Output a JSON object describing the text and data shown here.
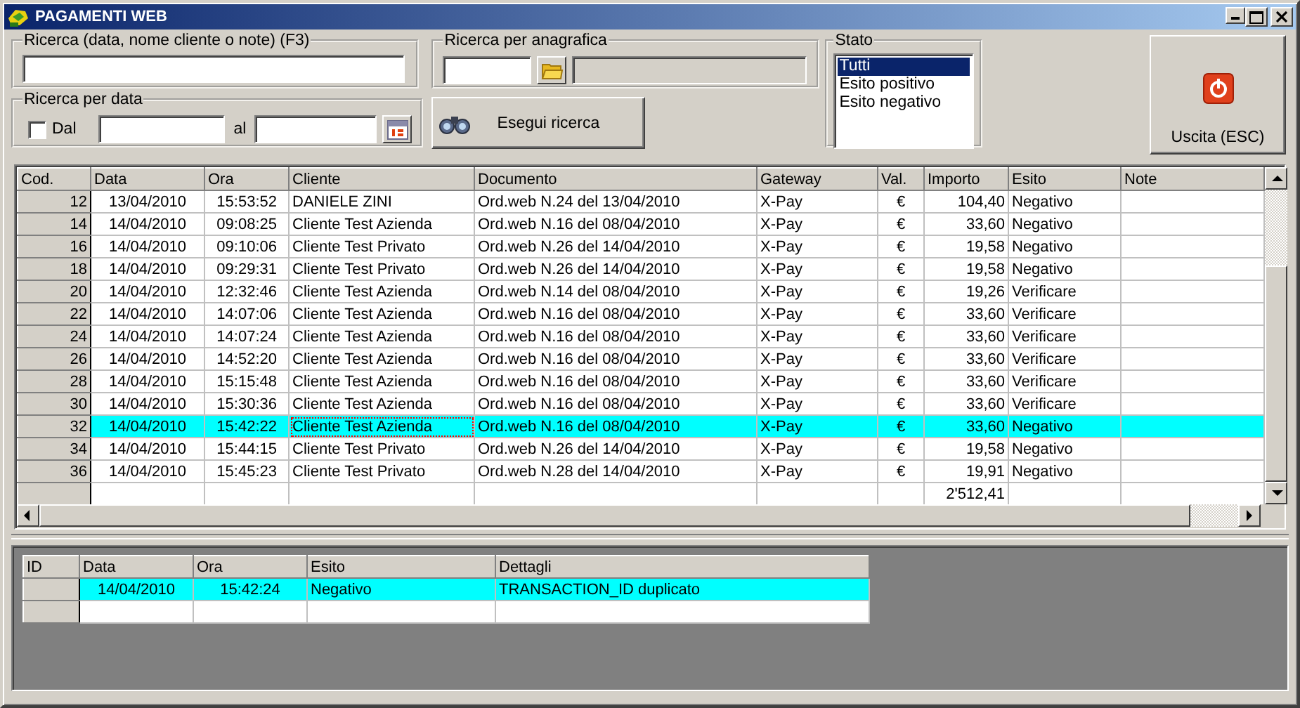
{
  "window": {
    "title": "PAGAMENTI WEB"
  },
  "search": {
    "label": "Ricerca (data, nome cliente o note) (F3)"
  },
  "anagrafica": {
    "label": "Ricerca per anagrafica"
  },
  "date_search": {
    "label": "Ricerca per data",
    "from_label": "Dal",
    "to_label": "al",
    "checked": false
  },
  "run_button": {
    "label": "Esegui ricerca"
  },
  "stato": {
    "label": "Stato",
    "items": [
      {
        "label": "Tutti",
        "selected": true
      },
      {
        "label": "Esito positivo",
        "selected": false
      },
      {
        "label": "Esito negativo",
        "selected": false
      }
    ]
  },
  "exit_button": {
    "label": "Uscita (ESC)"
  },
  "table": {
    "columns": [
      {
        "label": "Cod.",
        "focused": false
      },
      {
        "label": "Data",
        "focused": false
      },
      {
        "label": "Ora",
        "focused": false
      },
      {
        "label": "Cliente",
        "focused": true
      },
      {
        "label": "Documento",
        "focused": false
      },
      {
        "label": "Gateway",
        "focused": false
      },
      {
        "label": "Val.",
        "focused": false
      },
      {
        "label": "Importo",
        "focused": false
      },
      {
        "label": "Esito",
        "focused": false
      },
      {
        "label": "Note",
        "focused": false
      }
    ],
    "rows": [
      {
        "cells": [
          "12",
          "13/04/2010",
          "15:53:52",
          "DANIELE ZINI",
          "Ord.web N.24 del 13/04/2010",
          "X-Pay",
          "€",
          "104,40",
          "Negativo"
        ],
        "selected": false
      },
      {
        "cells": [
          "14",
          "14/04/2010",
          "09:08:25",
          "Cliente Test Azienda",
          "Ord.web N.16 del 08/04/2010",
          "X-Pay",
          "€",
          "33,60",
          "Negativo"
        ],
        "selected": false
      },
      {
        "cells": [
          "16",
          "14/04/2010",
          "09:10:06",
          "Cliente Test Privato",
          "Ord.web N.26 del 14/04/2010",
          "X-Pay",
          "€",
          "19,58",
          "Negativo"
        ],
        "selected": false
      },
      {
        "cells": [
          "18",
          "14/04/2010",
          "09:29:31",
          "Cliente Test Privato",
          "Ord.web N.26 del 14/04/2010",
          "X-Pay",
          "€",
          "19,58",
          "Negativo"
        ],
        "selected": false
      },
      {
        "cells": [
          "20",
          "14/04/2010",
          "12:32:46",
          "Cliente Test Azienda",
          "Ord.web N.14 del 08/04/2010",
          "X-Pay",
          "€",
          "19,26",
          "Verificare"
        ],
        "selected": false
      },
      {
        "cells": [
          "22",
          "14/04/2010",
          "14:07:06",
          "Cliente Test Azienda",
          "Ord.web N.16 del 08/04/2010",
          "X-Pay",
          "€",
          "33,60",
          "Verificare"
        ],
        "selected": false
      },
      {
        "cells": [
          "24",
          "14/04/2010",
          "14:07:24",
          "Cliente Test Azienda",
          "Ord.web N.16 del 08/04/2010",
          "X-Pay",
          "€",
          "33,60",
          "Verificare"
        ],
        "selected": false
      },
      {
        "cells": [
          "26",
          "14/04/2010",
          "14:52:20",
          "Cliente Test Azienda",
          "Ord.web N.16 del 08/04/2010",
          "X-Pay",
          "€",
          "33,60",
          "Verificare"
        ],
        "selected": false
      },
      {
        "cells": [
          "28",
          "14/04/2010",
          "15:15:48",
          "Cliente Test Azienda",
          "Ord.web N.16 del 08/04/2010",
          "X-Pay",
          "€",
          "33,60",
          "Verificare"
        ],
        "selected": false
      },
      {
        "cells": [
          "30",
          "14/04/2010",
          "15:30:36",
          "Cliente Test Azienda",
          "Ord.web N.16 del 08/04/2010",
          "X-Pay",
          "€",
          "33,60",
          "Verificare"
        ],
        "selected": false
      },
      {
        "cells": [
          "32",
          "14/04/2010",
          "15:42:22",
          "Cliente Test Azienda",
          "Ord.web N.16 del 08/04/2010",
          "X-Pay",
          "€",
          "33,60",
          "Negativo"
        ],
        "selected": true
      },
      {
        "cells": [
          "34",
          "14/04/2010",
          "15:44:15",
          "Cliente Test Privato",
          "Ord.web N.26 del 14/04/2010",
          "X-Pay",
          "€",
          "19,58",
          "Negativo"
        ],
        "selected": false
      },
      {
        "cells": [
          "36",
          "14/04/2010",
          "15:45:23",
          "Cliente Test Privato",
          "Ord.web N.28 del 14/04/2010",
          "X-Pay",
          "€",
          "19,91",
          "Negativo"
        ],
        "selected": false
      }
    ],
    "total": "2'512,41"
  },
  "details": {
    "columns": [
      "ID",
      "Data",
      "Ora",
      "Esito",
      "Dettagli"
    ],
    "rows": [
      {
        "cells": [
          "",
          "14/04/2010",
          "15:42:24",
          "Negativo",
          "TRANSACTION_ID duplicato"
        ],
        "selected": true
      }
    ]
  }
}
